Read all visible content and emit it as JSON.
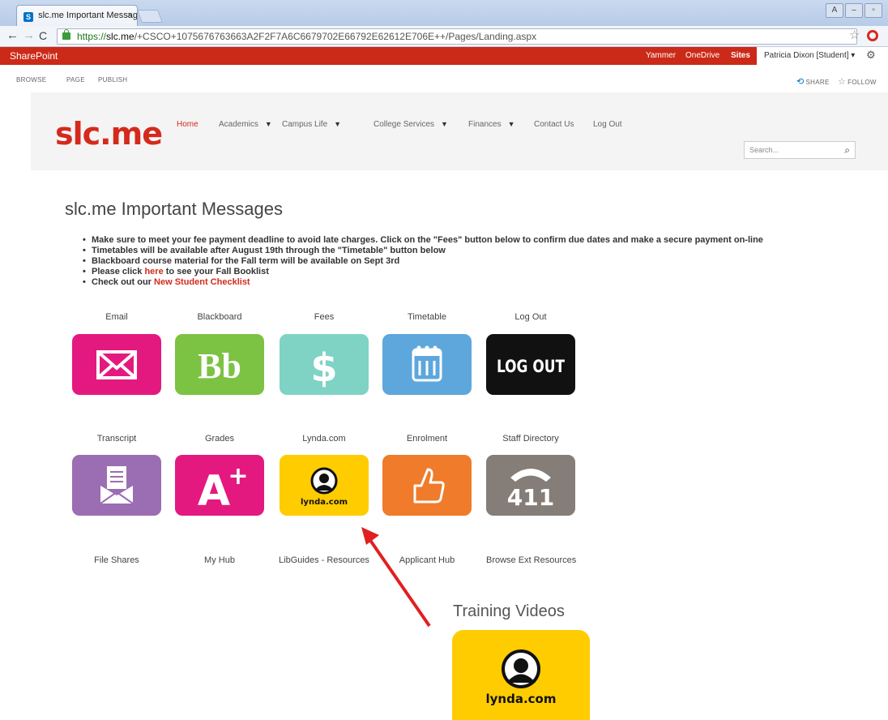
{
  "browser": {
    "tab_title": "slc.me Important Messag…",
    "tab_close": "×",
    "url_scheme": "https://",
    "url_host": "slc.me",
    "url_path": "/+CSCO+1075676763663A2F2F7A6C6679702E66792E62612E706E++/Pages/Landing.aspx"
  },
  "suite_bar": {
    "brand": "SharePoint",
    "links": [
      "Yammer",
      "OneDrive",
      "Sites"
    ],
    "user": "Patricia Dixon [Student] ▾"
  },
  "ribbon": {
    "tabs": [
      "BROWSE",
      "PAGE",
      "PUBLISH"
    ],
    "share": "SHARE",
    "follow": "FOLLOW"
  },
  "site": {
    "logo": "slc.me",
    "nav": [
      "Home",
      "Academics",
      "Campus Life",
      "College Services",
      "Finances",
      "Contact Us",
      "Log Out"
    ],
    "search_placeholder": "Search..."
  },
  "main": {
    "title": "slc.me Important Messages",
    "messages": [
      {
        "text": "Make sure to meet your fee payment deadline to avoid late charges. Click on the \"Fees\" button below to confirm due dates and make a secure payment on-line"
      },
      {
        "text": "Timetables will be available after August 19th through the \"Timetable\" button below"
      },
      {
        "text": "Blackboard course material for the Fall term will be available on Sept 3rd"
      },
      {
        "pre": "Please click ",
        "link": "here",
        "post": " to see your Fall Booklist"
      },
      {
        "pre": "Check out our ",
        "link": "New Student Checklist",
        "post": ""
      }
    ]
  },
  "tiles": {
    "row1": [
      "Email",
      "Blackboard",
      "Fees",
      "Timetable",
      "Log Out"
    ],
    "row2": [
      "Transcript",
      "Grades",
      "Lynda.com",
      "Enrolment",
      "Staff Directory"
    ],
    "row3": [
      "File Shares",
      "My Hub",
      "LibGuides - Resources",
      "Applicant Hub",
      "Browse Ext Resources"
    ],
    "glyphs": {
      "blackboard": "Bb",
      "fees": "$",
      "logout": "LOG OUT",
      "grades": "A",
      "grades_sup": "+",
      "lynda": "lynda.com",
      "staff": "411"
    },
    "colors": {
      "email": "#e4197f",
      "blackboard": "#7cc243",
      "fees": "#7ed3c5",
      "timetable": "#5da7dc",
      "logout": "#111111",
      "transcript": "#9b6db2",
      "grades": "#e4197f",
      "lynda": "#ffcc00",
      "enrolment": "#ef7b2b",
      "staff": "#857d78"
    }
  },
  "training": {
    "title": "Training Videos",
    "logo_text": "lynda.com"
  },
  "annotation": {
    "arrow_color": "#e02020"
  }
}
